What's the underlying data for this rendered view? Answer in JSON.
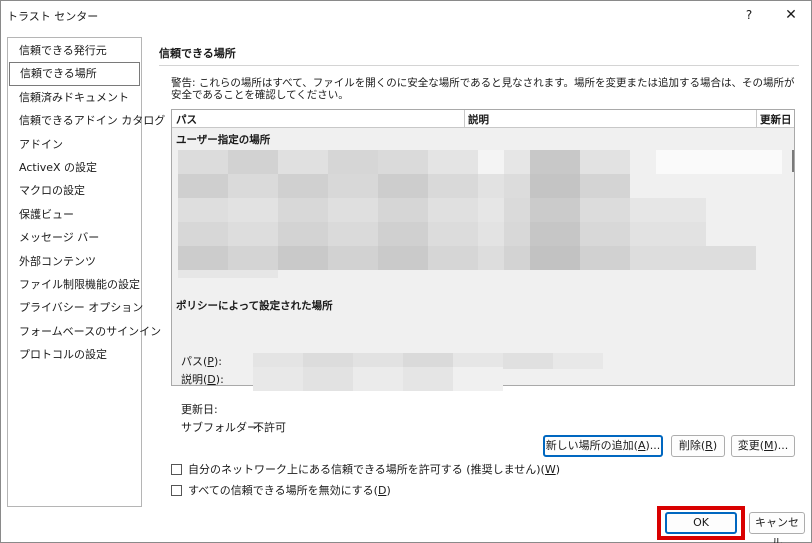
{
  "window": {
    "title": "トラスト センター",
    "help_label": "?",
    "close_label": "✕"
  },
  "nav": {
    "items": [
      {
        "label": "信頼できる発行元"
      },
      {
        "label": "信頼できる場所",
        "selected": true
      },
      {
        "label": "信頼済みドキュメント"
      },
      {
        "label": "信頼できるアドイン カタログ"
      },
      {
        "label": "アドイン"
      },
      {
        "label": "ActiveX の設定"
      },
      {
        "label": "マクロの設定"
      },
      {
        "label": "保護ビュー"
      },
      {
        "label": "メッセージ バー"
      },
      {
        "label": "外部コンテンツ"
      },
      {
        "label": "ファイル制限機能の設定"
      },
      {
        "label": "プライバシー オプション"
      },
      {
        "label": "フォームベースのサインイン"
      },
      {
        "label": "プロトコルの設定"
      }
    ]
  },
  "main": {
    "section_title": "信頼できる場所",
    "warning": "警告: これらの場所はすべて、ファイルを開くのに安全な場所であると見なされます。場所を変更または追加する場合は、その場所が安全であることを確認してください。",
    "columns": {
      "path": "パス",
      "description": "説明",
      "modified": "更新日"
    },
    "group_user": "ユーザー指定の場所",
    "group_policy": "ポリシーによって設定された場所",
    "details": {
      "path_label": "パス(P):",
      "description_label": "説明(D):",
      "modified_label": "更新日:",
      "subfolder_label": "サブフォルダー:",
      "subfolder_value": "不許可"
    },
    "buttons": {
      "add_new": "新しい場所の追加(A)...",
      "remove": "削除(R)",
      "modify": "変更(M)..."
    },
    "checkboxes": {
      "allow_network": "自分のネットワーク上にある信頼できる場所を許可する (推奨しません)(W)",
      "disable_all": "すべての信頼できる場所を無効にする(D)"
    }
  },
  "footer": {
    "ok": "OK",
    "cancel": "キャンセル"
  },
  "colors": {
    "highlight": "#d90000",
    "default_button_border": "#0067c0",
    "list_background": "#f0f0f0"
  }
}
